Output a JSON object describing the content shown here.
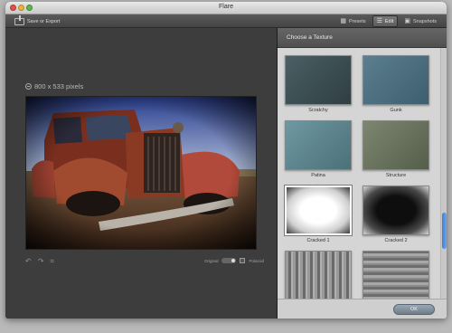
{
  "window": {
    "title": "Flare"
  },
  "toolbar": {
    "save_label": "Save or Export"
  },
  "tabs": [
    {
      "label": "Presets",
      "icon": "grid-icon"
    },
    {
      "label": "Edit",
      "icon": "sliders-icon",
      "active": true
    },
    {
      "label": "Snapshots",
      "icon": "camera-icon"
    }
  ],
  "canvas": {
    "dimensions": "800 x 533 pixels"
  },
  "controls": {
    "original_label": "Original",
    "polaroid_label": "Polaroid"
  },
  "panel": {
    "title": "Choose a Texture",
    "textures": [
      {
        "name": "Scratchy",
        "color": "#3f5358"
      },
      {
        "name": "Gunk",
        "color": "#4d6f80"
      },
      {
        "name": "Patina",
        "color": "#5f8792"
      },
      {
        "name": "Structure",
        "color": "#6c7760"
      },
      {
        "name": "Cracked 1",
        "color": "#ffffff",
        "selected": true
      },
      {
        "name": "Cracked 2",
        "color": "#111111"
      },
      {
        "name": "",
        "color": "#888888"
      },
      {
        "name": "",
        "color": "#999999"
      }
    ],
    "ok_label": "OK"
  },
  "colors": {
    "accent": "#3f7ed8",
    "panel": "#d5d5d5",
    "canvas": "#3d3d3d"
  }
}
